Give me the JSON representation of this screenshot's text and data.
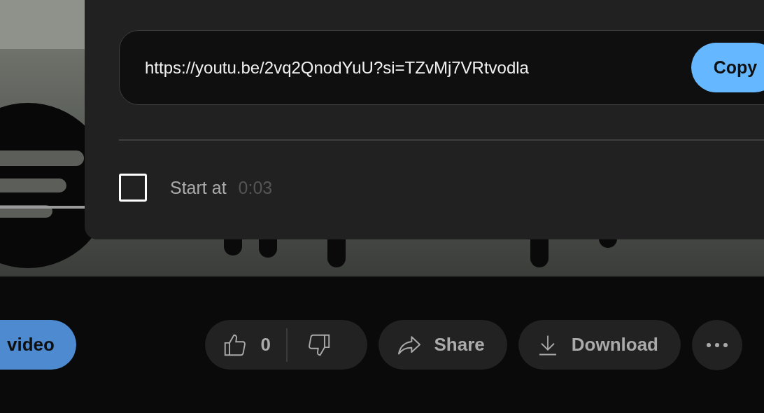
{
  "share_dialog": {
    "link": "https://youtu.be/2vq2QnodYuU?si=TZvMj7VRtvodla",
    "copy_button": "Copy",
    "start_at": {
      "checked": false,
      "label": "Start at",
      "time": "0:03"
    }
  },
  "actions": {
    "left_button": "video",
    "likes": "0",
    "share": "Share",
    "download": "Download"
  }
}
